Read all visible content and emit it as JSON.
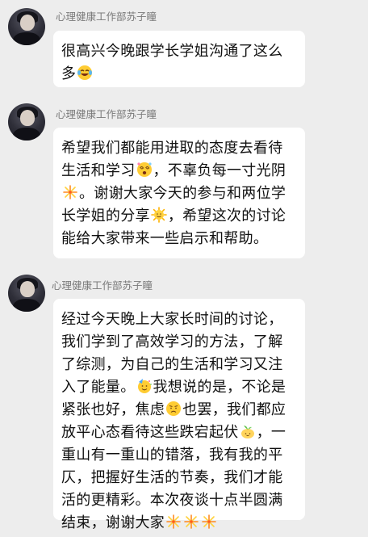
{
  "messages": [
    {
      "sender": "心理健康工作部苏子瞳",
      "segments": [
        {
          "t": "很高兴今晚跟学长学姐沟通了这么多"
        },
        {
          "emoji": "laughing-tears-emoji"
        }
      ]
    },
    {
      "sender": "心理健康工作部苏子瞳",
      "segments": [
        {
          "t": "希望我们都能用进取的态度去看待生活和学习"
        },
        {
          "emoji": "dizzy-face-emoji"
        },
        {
          "t": "，不辜负每一寸光阴"
        },
        {
          "emoji": "fireworks-emoji"
        },
        {
          "t": "。谢谢大家今天的参与和两位学长学姐的分享"
        },
        {
          "emoji": "sun-emoji"
        },
        {
          "t": "，希望这次的讨论能给大家带来一些启示和帮助。"
        }
      ]
    },
    {
      "sender": "心理健康工作部苏子瞳",
      "segments": [
        {
          "t": "经过今天晚上大家长时间的讨论，我们学到了高效学习的方法，了解了综测，为自己的生活和学习又注入了能量。"
        },
        {
          "emoji": "party-face-emoji"
        },
        {
          "t": "我想说的是，不论是紧张也好，焦虑"
        },
        {
          "emoji": "worried-face-emoji"
        },
        {
          "t": "也罢，我们都应放平心态看待这些跌宕起伏"
        },
        {
          "emoji": "bean-sprout-emoji"
        },
        {
          "t": "，一重山有一重山的错落，我有我的平仄，把握好生活的节奏，我们才能活的更精彩。本次夜谈十点半圆满结束，谢谢大家"
        },
        {
          "emoji": "fireworks-emoji"
        },
        {
          "emoji": "fireworks-emoji"
        },
        {
          "emoji": "fireworks-emoji"
        }
      ]
    }
  ]
}
